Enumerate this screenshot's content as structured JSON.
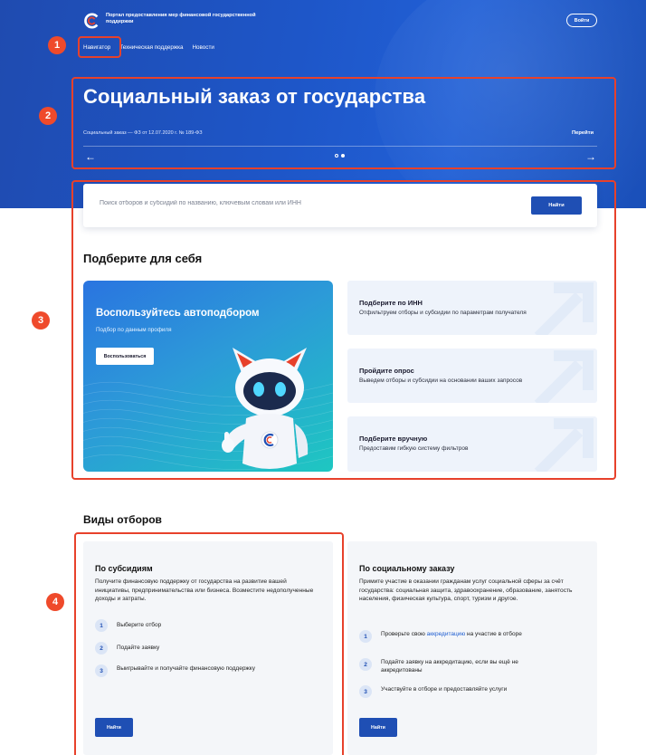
{
  "header": {
    "portal_title": "Портал предоставления мер финансовой государственной поддержки",
    "login_label": "Войти",
    "nav": [
      "Навигатор",
      "Техническая поддержка",
      "Новости"
    ]
  },
  "hero": {
    "title": "Социальный заказ от государства",
    "subtitle": "Социальный заказ — ФЗ от 12.07.2020 г. № 189-ФЗ",
    "go_label": "Перейти",
    "prev_arrow": "←",
    "next_arrow": "→",
    "slides_total": 2,
    "active_slide": 2
  },
  "search": {
    "placeholder": "Поиск отборов и субсидий по названию, ключевым словам или ИНН",
    "button_label": "Найти"
  },
  "pick": {
    "title": "Подберите для себя",
    "auto": {
      "title": "Воспользуйтесь автоподбором",
      "subtitle": "Подбор по данным профиля",
      "button_label": "Воспользоваться"
    },
    "options": [
      {
        "title": "Подберите по ИНН",
        "desc": "Отфильтруем отборы и субсидии по параметрам получателя"
      },
      {
        "title": "Пройдите опрос",
        "desc": "Выведем отборы и субсидии на основании ваших запросов"
      },
      {
        "title": "Подберите вручную",
        "desc": "Предоставим гибкую систему фильтров"
      }
    ]
  },
  "types": {
    "title": "Виды отборов",
    "subsidies": {
      "title": "По субсидиям",
      "desc": "Получите финансовую поддержку от государства на развитие вашей инициативы, предпринимательства или бизнеса. Возместите недополученные доходы и затраты.",
      "steps": [
        "Выберите отбор",
        "Подайте заявку",
        "Выигрывайте и получайте финансовую поддержку"
      ],
      "button_label": "Найти"
    },
    "social": {
      "title": "По социальному заказу",
      "desc": "Примите участие в оказании гражданам услуг социальной сферы за счёт государства: социальная защита, здравоохранение, образование, занятость населения, физическая культура, спорт, туризм и другое.",
      "step1_pre": "Проверьте свою ",
      "step1_link": "аккредитацию",
      "step1_post": " на участие в отборе",
      "steps": [
        "Подайте заявку на аккредитацию, если вы ещё не аккредитованы",
        "Участвуйте в отборе и предоставляйте услуги"
      ],
      "button_label": "Найти"
    }
  },
  "callouts": [
    "1",
    "2",
    "3",
    "4"
  ],
  "step_numbers": [
    "1",
    "2",
    "3"
  ],
  "colors": {
    "primary": "#1f4fb4",
    "callout": "#ef4a2b",
    "hero": "#1e56c8"
  }
}
